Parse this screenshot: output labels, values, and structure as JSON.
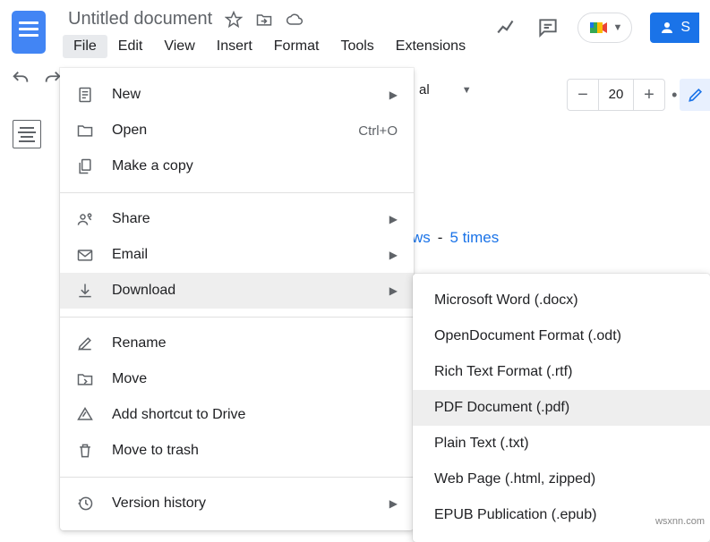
{
  "header": {
    "title": "Untitled document",
    "menu": [
      "File",
      "Edit",
      "View",
      "Insert",
      "Format",
      "Tools",
      "Extensions"
    ]
  },
  "toolbar": {
    "font": "al",
    "zoom": "20"
  },
  "share_label": "S",
  "doc_content": {
    "text1": "ws",
    "text2": "-",
    "text3": "5 times"
  },
  "file_menu": {
    "new": "New",
    "open": "Open",
    "open_shortcut": "Ctrl+O",
    "make_copy": "Make a copy",
    "share": "Share",
    "email": "Email",
    "download": "Download",
    "rename": "Rename",
    "move": "Move",
    "add_shortcut": "Add shortcut to Drive",
    "move_trash": "Move to trash",
    "version_history": "Version history"
  },
  "download_submenu": {
    "docx": "Microsoft Word (.docx)",
    "odt": "OpenDocument Format (.odt)",
    "rtf": "Rich Text Format (.rtf)",
    "pdf": "PDF Document (.pdf)",
    "txt": "Plain Text (.txt)",
    "html": "Web Page (.html, zipped)",
    "epub": "EPUB Publication (.epub)"
  },
  "watermark": "wsxnn.com"
}
